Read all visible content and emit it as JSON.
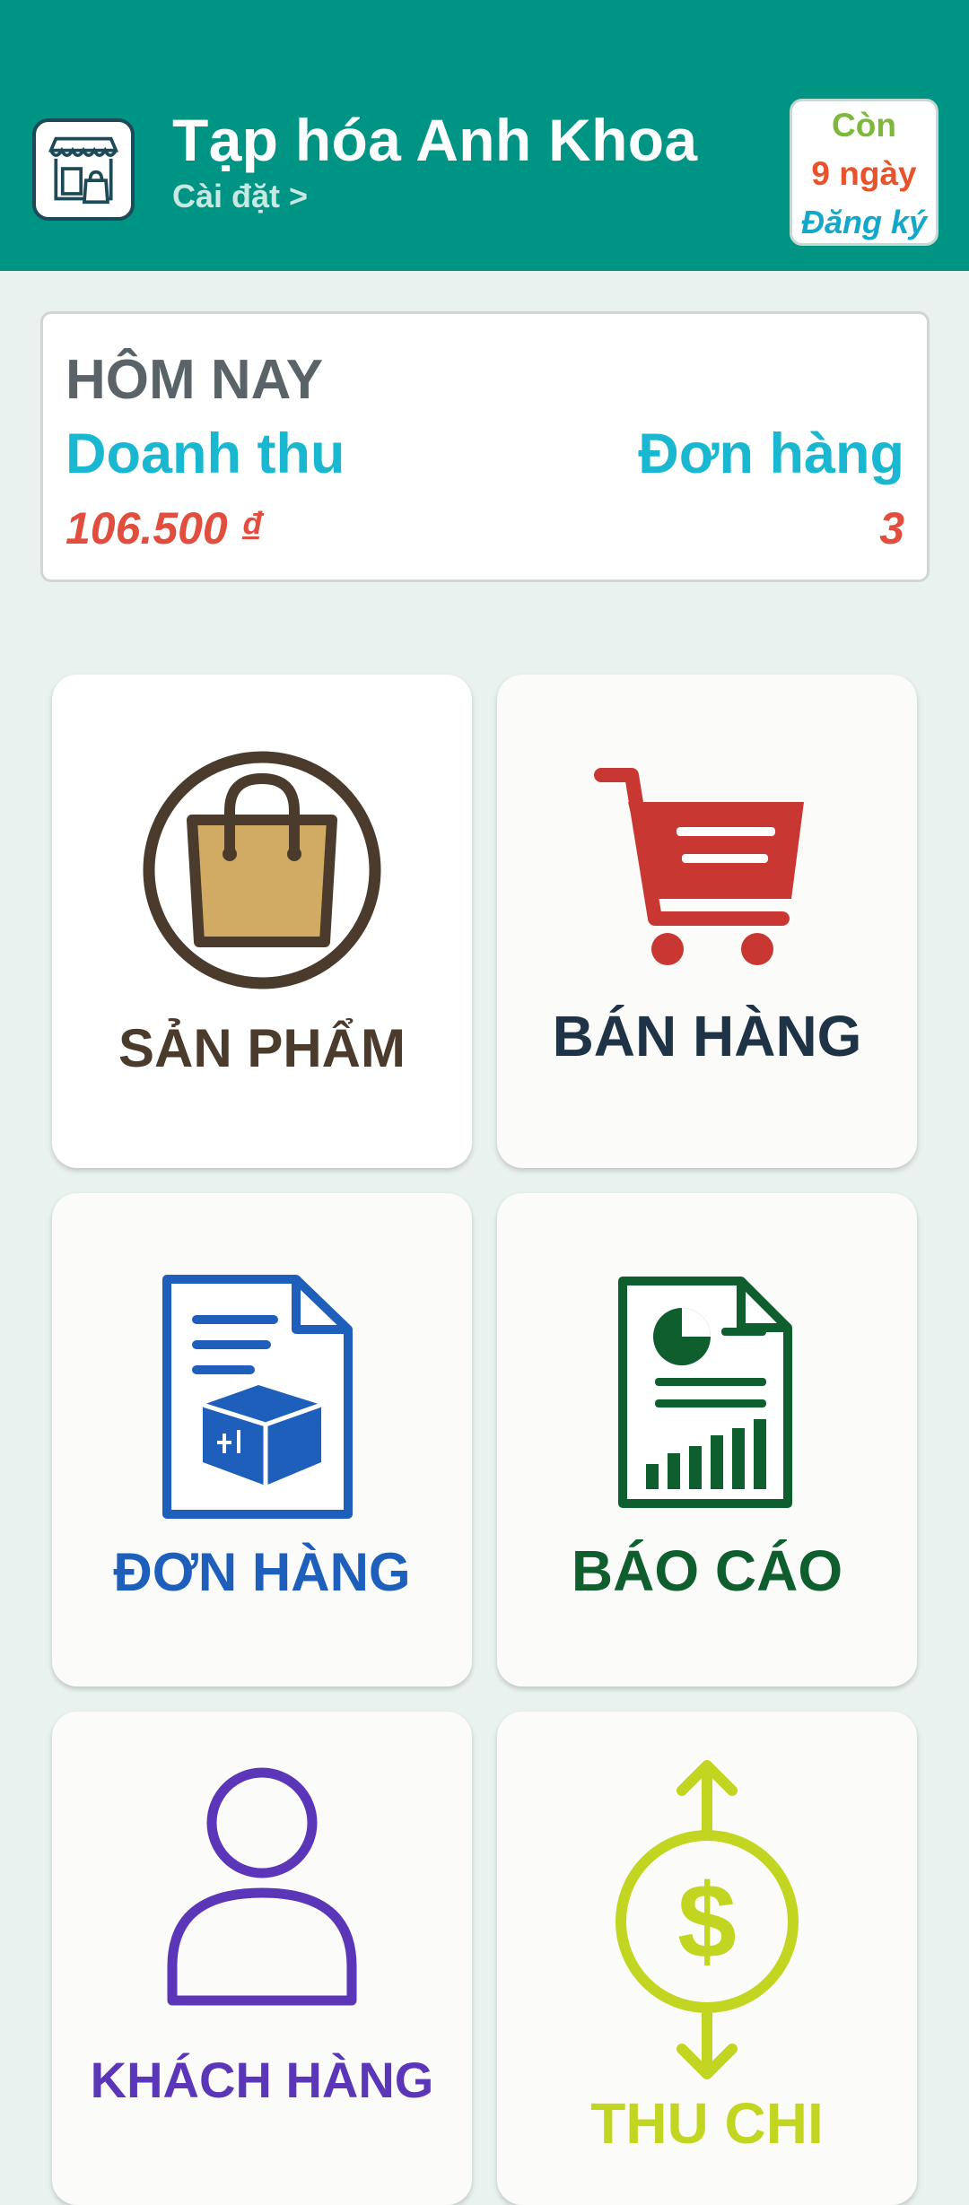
{
  "header": {
    "store_name": "Tạp hóa Anh Khoa",
    "settings_link": "Cài đặt >",
    "trial": {
      "line1": "Còn",
      "line2": "9 ngày",
      "line3": "Đăng ký"
    }
  },
  "today": {
    "title": "HÔM NAY",
    "revenue_label": "Doanh thu",
    "orders_label": "Đơn hàng",
    "revenue_value": "106.500 ₫",
    "orders_value": "3"
  },
  "tiles": [
    {
      "label": "SẢN PHẨM",
      "icon": "shopping-bag-icon",
      "color": "#4A3B2C"
    },
    {
      "label": "BÁN HÀNG",
      "icon": "shopping-cart-icon",
      "color": "#1F3347"
    },
    {
      "label": "ĐƠN HÀNG",
      "icon": "order-document-icon",
      "color": "#1E5FBB"
    },
    {
      "label": "BÁO CÁO",
      "icon": "report-document-icon",
      "color": "#0E5E2E"
    },
    {
      "label": "KHÁCH HÀNG",
      "icon": "customer-person-icon",
      "color": "#5B36B8"
    },
    {
      "label": "THU CHI",
      "icon": "dollar-exchange-icon",
      "color": "#C2D621"
    }
  ],
  "colors": {
    "header_bg": "#009485",
    "page_bg": "#E9F2EE",
    "accent_cyan": "#19B8D0",
    "value_red": "#E14E3D"
  }
}
